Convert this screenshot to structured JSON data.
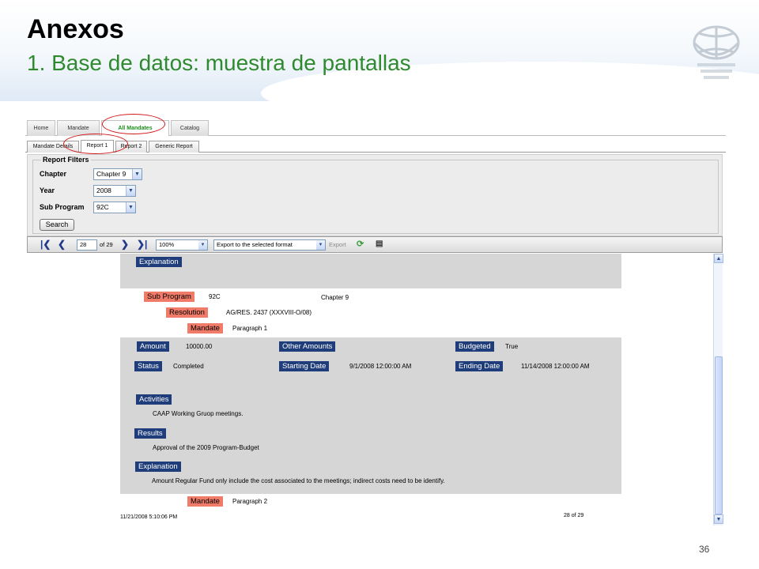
{
  "slide": {
    "title": "Anexos",
    "subtitle": "1. Base de datos: muestra de pantallas",
    "page_number": "36"
  },
  "app": {
    "main_tabs": [
      "Home",
      "Mandate",
      "All Mandates",
      "Catalog"
    ],
    "active_main_tab": "All Mandates",
    "sub_tabs": [
      "Mandate Details",
      "Report 1",
      "Report 2",
      "Generic Report"
    ],
    "active_sub_tab": "Report 1"
  },
  "filters": {
    "legend": "Report Filters",
    "chapter_label": "Chapter",
    "chapter_value": "Chapter 9",
    "year_label": "Year",
    "year_value": "2008",
    "subprogram_label": "Sub Program",
    "subprogram_value": "92C",
    "search_label": "Search"
  },
  "toolbar": {
    "current_page": "28",
    "of_pages": "of 29",
    "zoom": "100%",
    "export_format": "Export to the selected format",
    "export_label": "Export"
  },
  "report": {
    "explanation_label": "Explanation",
    "subprogram_label": "Sub Program",
    "subprogram_value": "92C",
    "chapter_value": "Chapter 9",
    "resolution_label": "Resolution",
    "resolution_value": "AG/RES. 2437 (XXXVIII-O/08)",
    "mandate_label": "Mandate",
    "mandate_value": "Paragraph 1",
    "amount_label": "Amount",
    "amount_value": "10000.00",
    "other_amounts_label": "Other Amounts",
    "budgeted_label": "Budgeted",
    "budgeted_value": "True",
    "status_label": "Status",
    "status_value": "Completed",
    "starting_date_label": "Starting Date",
    "starting_date_value": "9/1/2008 12:00:00 AM",
    "ending_date_label": "Ending Date",
    "ending_date_value": "11/14/2008 12:00:00 AM",
    "activities_label": "Activities",
    "activities_value": "CAAP Working Gruop meetings.",
    "results_label": "Results",
    "results_value": "Approval of the 2009 Program-Budget",
    "explanation2_label": "Explanation",
    "explanation2_value": "Amount Regular Fund only include the cost associated to the meetings; indirect costs need to be identify.",
    "mandate2_label": "Mandate",
    "mandate2_value": "Paragraph 2",
    "footer_timestamp": "11/21/2008 5:10:06 PM",
    "footer_page": "28 of 29"
  },
  "colors": {
    "title_green": "#2f8a2f",
    "label_blue": "#1f3d7a",
    "label_salmon": "#f07b68",
    "annotation_red": "#d11818"
  }
}
